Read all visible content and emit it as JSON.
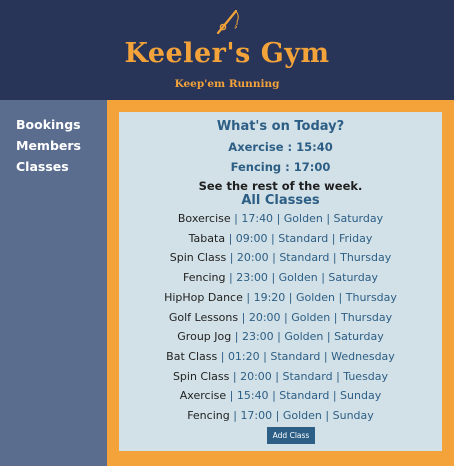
{
  "header": {
    "title": "Keeler's Gym",
    "tagline": "Keep'em Running",
    "logo_icon": "fishing-rod-icon",
    "accent_color": "#f3a33a",
    "background_color": "#283558"
  },
  "sidebar": {
    "items": [
      {
        "label": "Bookings"
      },
      {
        "label": "Members"
      },
      {
        "label": "Classes"
      }
    ]
  },
  "today": {
    "heading": "What's on Today?",
    "items": [
      {
        "text": "Axercise : 15:40"
      },
      {
        "text": "Fencing : 17:00"
      }
    ]
  },
  "week": {
    "rest_text": "See the rest of the week.",
    "heading": "All Classes",
    "classes": [
      {
        "name": "Boxercise",
        "time": "17:40",
        "level": "Golden",
        "day": "Saturday"
      },
      {
        "name": "Tabata",
        "time": "09:00",
        "level": "Standard",
        "day": "Friday"
      },
      {
        "name": "Spin Class",
        "time": "20:00",
        "level": "Standard",
        "day": "Thursday"
      },
      {
        "name": "Fencing",
        "time": "23:00",
        "level": "Golden",
        "day": "Saturday"
      },
      {
        "name": "HipHop Dance",
        "time": "19:20",
        "level": "Golden",
        "day": "Thursday"
      },
      {
        "name": "Golf Lessons",
        "time": "20:00",
        "level": "Golden",
        "day": "Thursday"
      },
      {
        "name": "Group Jog",
        "time": "23:00",
        "level": "Golden",
        "day": "Saturday"
      },
      {
        "name": "Bat Class",
        "time": "01:20",
        "level": "Standard",
        "day": "Wednesday"
      },
      {
        "name": "Spin Class",
        "time": "20:00",
        "level": "Standard",
        "day": "Tuesday"
      },
      {
        "name": "Axercise",
        "time": "15:40",
        "level": "Standard",
        "day": "Sunday"
      },
      {
        "name": "Fencing",
        "time": "17:00",
        "level": "Golden",
        "day": "Sunday"
      }
    ],
    "separator": "|",
    "add_button_label": "Add Class"
  }
}
